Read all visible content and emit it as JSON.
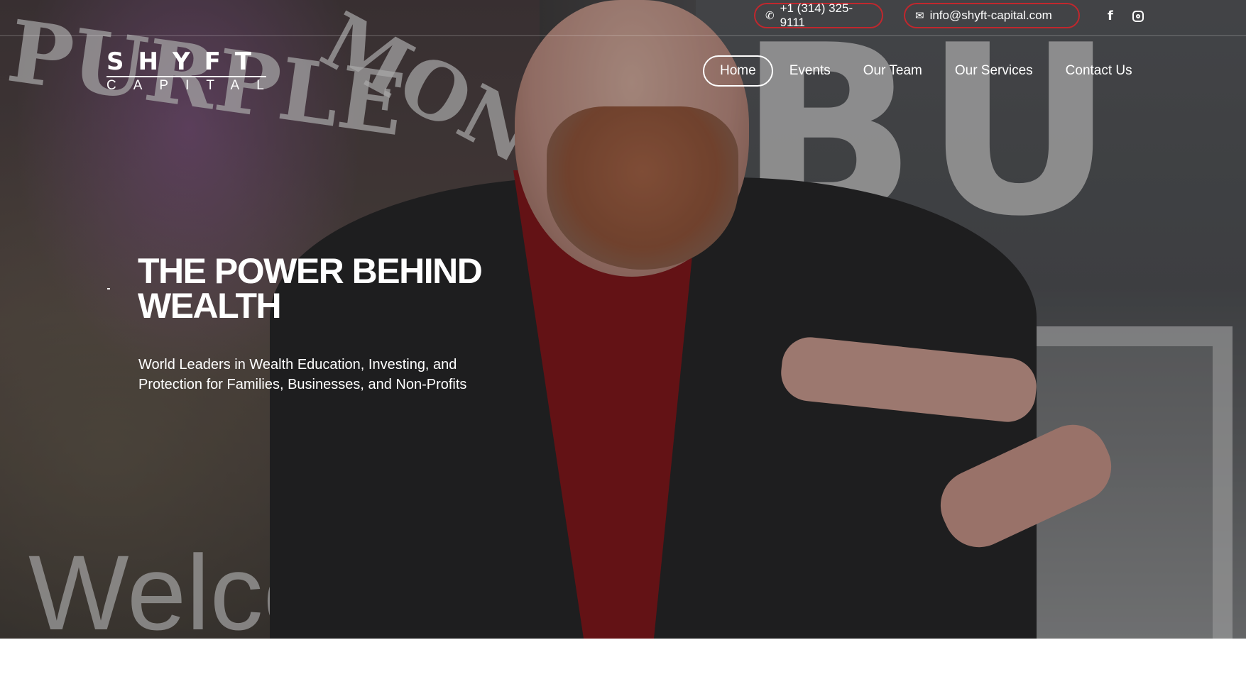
{
  "brand": {
    "logo_top": "SHYFT",
    "logo_bottom": "CAPITAL",
    "logo_accent_color": "#c1272d"
  },
  "topbar": {
    "phone": "+1 (314) 325-9111",
    "phone_icon": "phone-icon",
    "email": "info@shyft-capital.com",
    "email_icon": "envelope-icon",
    "social": [
      "facebook-icon",
      "instagram-icon"
    ],
    "pill_border_color": "#c1272d"
  },
  "nav": {
    "items": [
      {
        "label": "Home",
        "active": true
      },
      {
        "label": "Events",
        "active": false
      },
      {
        "label": "Our Team",
        "active": false
      },
      {
        "label": "Our Services",
        "active": false
      },
      {
        "label": "Contact Us",
        "active": false
      }
    ]
  },
  "hero": {
    "headline": "THE POWER BEHIND WEALTH",
    "subheadline": "World Leaders in Wealth Education, Investing, and Protection for Families, Businesses, and Non-Profits"
  }
}
